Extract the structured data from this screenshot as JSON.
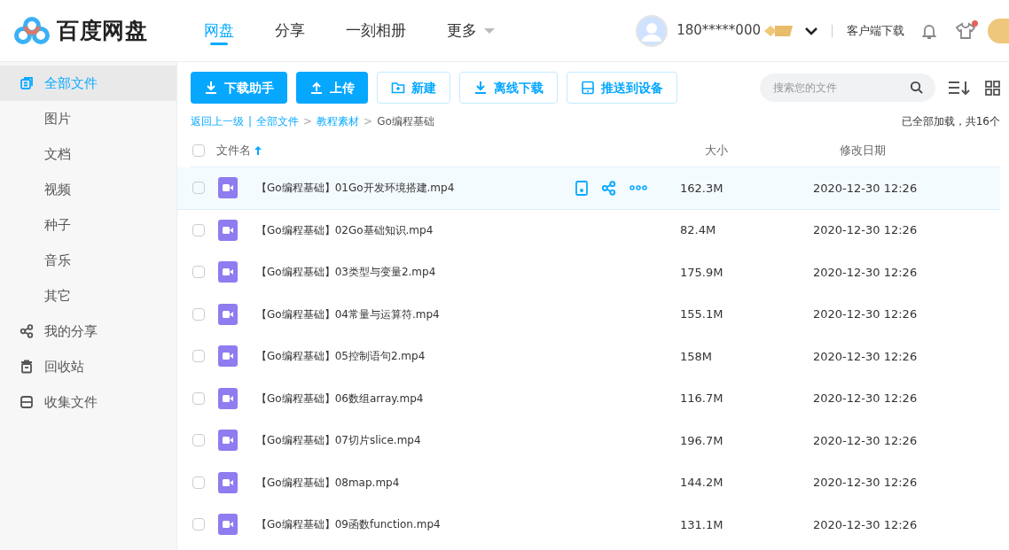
{
  "logo": {
    "text": "百度网盘"
  },
  "nav": [
    {
      "label": "网盘",
      "selected": true
    },
    {
      "label": "分享",
      "selected": false
    },
    {
      "label": "一刻相册",
      "selected": false
    },
    {
      "label": "更多",
      "selected": false,
      "dropdown": true
    }
  ],
  "user": {
    "name": "180*****000",
    "notification_dot": true
  },
  "client_download": "客户端下载",
  "sidebar": {
    "items": [
      {
        "label": "全部文件",
        "kind": "files",
        "selected": true
      },
      {
        "label": "图片",
        "kind": "category",
        "selected": false
      },
      {
        "label": "文档",
        "kind": "category",
        "selected": false
      },
      {
        "label": "视频",
        "kind": "category",
        "selected": false
      },
      {
        "label": "种子",
        "kind": "category",
        "selected": false
      },
      {
        "label": "音乐",
        "kind": "category",
        "selected": false
      },
      {
        "label": "其它",
        "kind": "category",
        "selected": false
      },
      {
        "label": "我的分享",
        "kind": "share",
        "selected": false
      },
      {
        "label": "回收站",
        "kind": "trash",
        "selected": false
      },
      {
        "label": "收集文件",
        "kind": "collect",
        "selected": false
      }
    ]
  },
  "toolbar": [
    {
      "label": "下载助手",
      "kind": "primary"
    },
    {
      "label": "上传",
      "kind": "primary"
    },
    {
      "label": "新建",
      "kind": "outline"
    },
    {
      "label": "离线下载",
      "kind": "outline"
    },
    {
      "label": "推送到设备",
      "kind": "outline"
    }
  ],
  "search": {
    "placeholder": "搜索您的文件"
  },
  "breadcrumb": [
    {
      "label": "返回上一级",
      "link": true
    },
    {
      "separator": "|",
      "label": "全部文件",
      "link": true
    },
    {
      "separator": ">",
      "label": "教程素材",
      "link": true
    },
    {
      "separator": ">",
      "label": "Go编程基础",
      "link": false
    }
  ],
  "load_status": "已全部加载，共16个",
  "table": {
    "select_all_checked": false,
    "columns": [
      "文件名",
      "大小",
      "修改日期"
    ],
    "rows": [
      {
        "name": "【Go编程基础】01Go开发环境搭建.mp4",
        "size": "162.3M",
        "date": "2020-12-30 12:26",
        "hovered": true,
        "checked": false
      },
      {
        "name": "【Go编程基础】02Go基础知识.mp4",
        "size": "82.4M",
        "date": "2020-12-30 12:26",
        "hovered": false,
        "checked": false
      },
      {
        "name": "【Go编程基础】03类型与变量2.mp4",
        "size": "175.9M",
        "date": "2020-12-30 12:26",
        "hovered": false,
        "checked": false
      },
      {
        "name": "【Go编程基础】04常量与运算符.mp4",
        "size": "155.1M",
        "date": "2020-12-30 12:26",
        "hovered": false,
        "checked": false
      },
      {
        "name": "【Go编程基础】05控制语句2.mp4",
        "size": "158M",
        "date": "2020-12-30 12:26",
        "hovered": false,
        "checked": false
      },
      {
        "name": "【Go编程基础】06数组array.mp4",
        "size": "116.7M",
        "date": "2020-12-30 12:26",
        "hovered": false,
        "checked": false
      },
      {
        "name": "【Go编程基础】07切片slice.mp4",
        "size": "196.7M",
        "date": "2020-12-30 12:26",
        "hovered": false,
        "checked": false
      },
      {
        "name": "【Go编程基础】08map.mp4",
        "size": "144.2M",
        "date": "2020-12-30 12:26",
        "hovered": false,
        "checked": false
      },
      {
        "name": "【Go编程基础】09函数function.mp4",
        "size": "131.1M",
        "date": "2020-12-30 12:26",
        "hovered": false,
        "checked": false
      }
    ]
  }
}
